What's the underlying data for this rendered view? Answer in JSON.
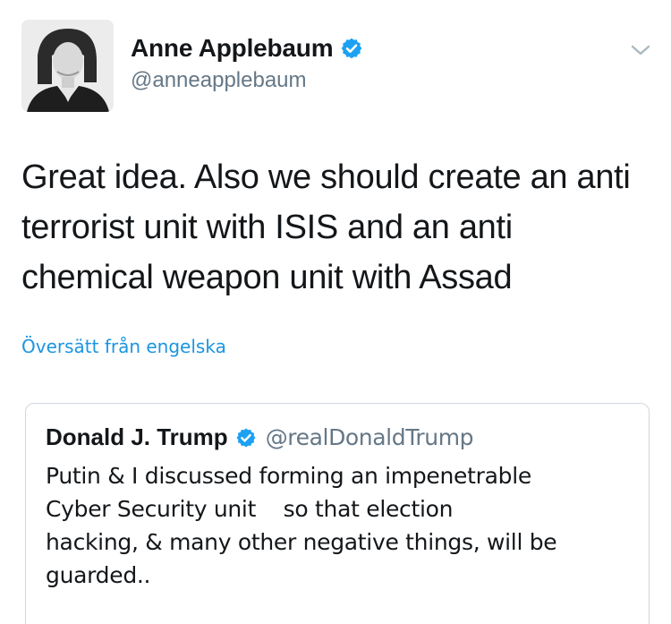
{
  "tweet": {
    "author": {
      "display_name": "Anne Applebaum",
      "handle": "@anneapplebaum",
      "verified": true,
      "avatar_icon": "user-avatar-photo",
      "verified_icon": "verified-badge-icon"
    },
    "menu_icon": "chevron-down-icon",
    "text": "Great idea. Also we should create an anti terrorist unit with ISIS and an anti chemical weapon unit with Assad",
    "translate_link": "Översätt från engelska"
  },
  "quoted_tweet": {
    "author": {
      "display_name": "Donald J. Trump",
      "handle": "@realDonaldTrump",
      "verified": true,
      "verified_icon": "verified-badge-icon"
    },
    "text": "Putin & I discussed forming an impenetrable\nCyber Security unit    so that election\nhacking, & many other negative things, will be\nguarded.."
  },
  "colors": {
    "text_primary": "#14171a",
    "text_secondary": "#657786",
    "link": "#1b95e0",
    "verified": "#1da1f2",
    "border": "#d0d7de"
  }
}
